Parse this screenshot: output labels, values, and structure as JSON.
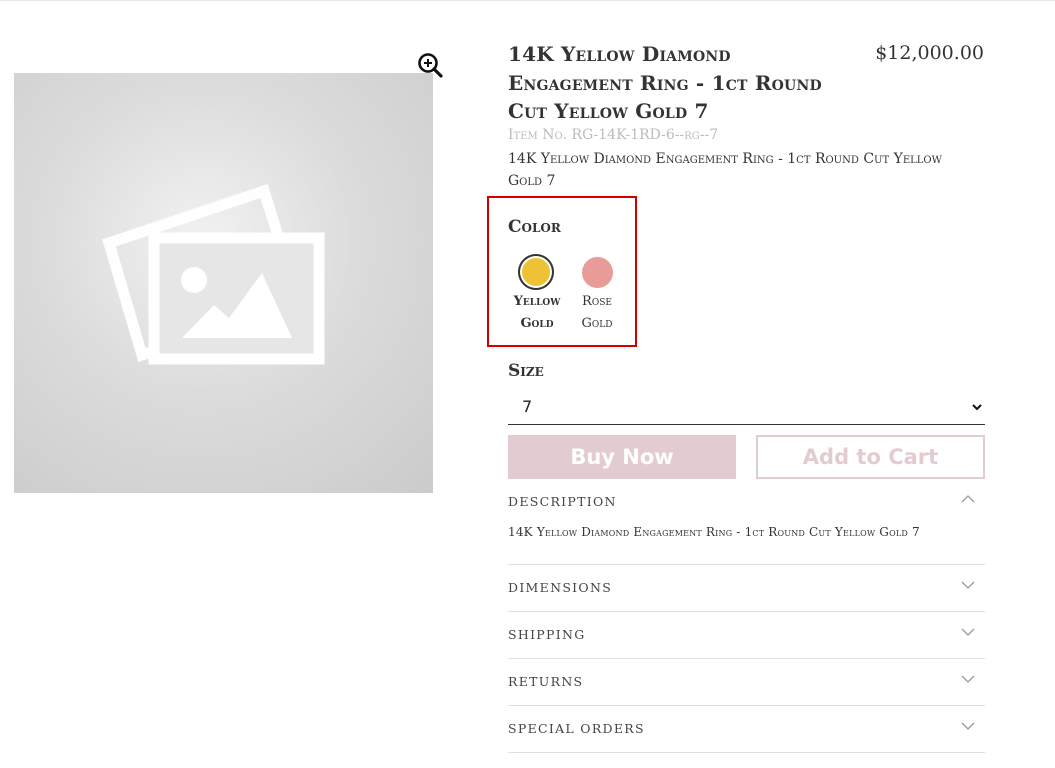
{
  "product": {
    "title": "14K Yellow Diamond Engagement Ring - 1ct Round Cut Yellow Gold 7",
    "price": "$12,000.00",
    "sku": "Item No. RG-14K-1RD-6--rg--7",
    "short_description": "14K Yellow Diamond Engagement Ring - 1ct Round Cut Yellow Gold 7",
    "image_icon": "image-placeholder-icon"
  },
  "color": {
    "label": "Color",
    "options": [
      {
        "name": "Yellow Gold",
        "hex": "#efc236",
        "selected": true
      },
      {
        "name": "Rose Gold",
        "hex": "#e99b98",
        "selected": false
      }
    ]
  },
  "size": {
    "label": "Size",
    "selected": "7"
  },
  "buttons": {
    "buy_now": "Buy Now",
    "add_to_cart": "Add to Cart"
  },
  "accordion": [
    {
      "label": "Description",
      "open": true,
      "content": "14K Yellow Diamond Engagement Ring - 1ct Round Cut Yellow Gold 7"
    },
    {
      "label": "Dimensions",
      "open": false
    },
    {
      "label": "Shipping",
      "open": false
    },
    {
      "label": "Returns",
      "open": false
    },
    {
      "label": "Special Orders",
      "open": false
    }
  ],
  "colors": {
    "highlight_border": "#d40000",
    "button_accent": "#e2ccd0"
  }
}
